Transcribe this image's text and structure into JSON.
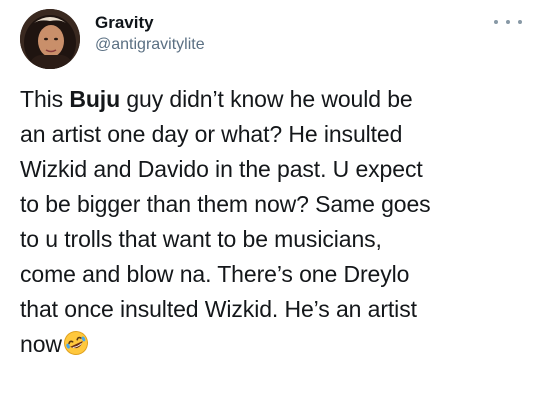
{
  "tweet": {
    "author": {
      "display_name": "Gravity",
      "handle": "@antigravitylite"
    },
    "body": {
      "l1_a": "This ",
      "l1_bold": "Buju",
      "l1_b": " guy didn’t know he would be",
      "l2": "an artist one day or what? He insulted",
      "l3": "Wizkid and Davido in the past. U expect",
      "l4": "to be bigger than them now? Same goes",
      "l5": "to u trolls that want to be musicians,",
      "l6": "come and blow na. There’s one  Dreylo",
      "l7": "that once insulted Wizkid. He’s an artist",
      "l8": "now"
    },
    "emoji": "rolling-on-the-floor-laughing-emoji",
    "more_icon": "more-horizontal-icon"
  },
  "colors": {
    "text": "#14171a",
    "secondary": "#5b7083",
    "icon": "#8899a6",
    "emoji_face": "#ffc83d"
  }
}
